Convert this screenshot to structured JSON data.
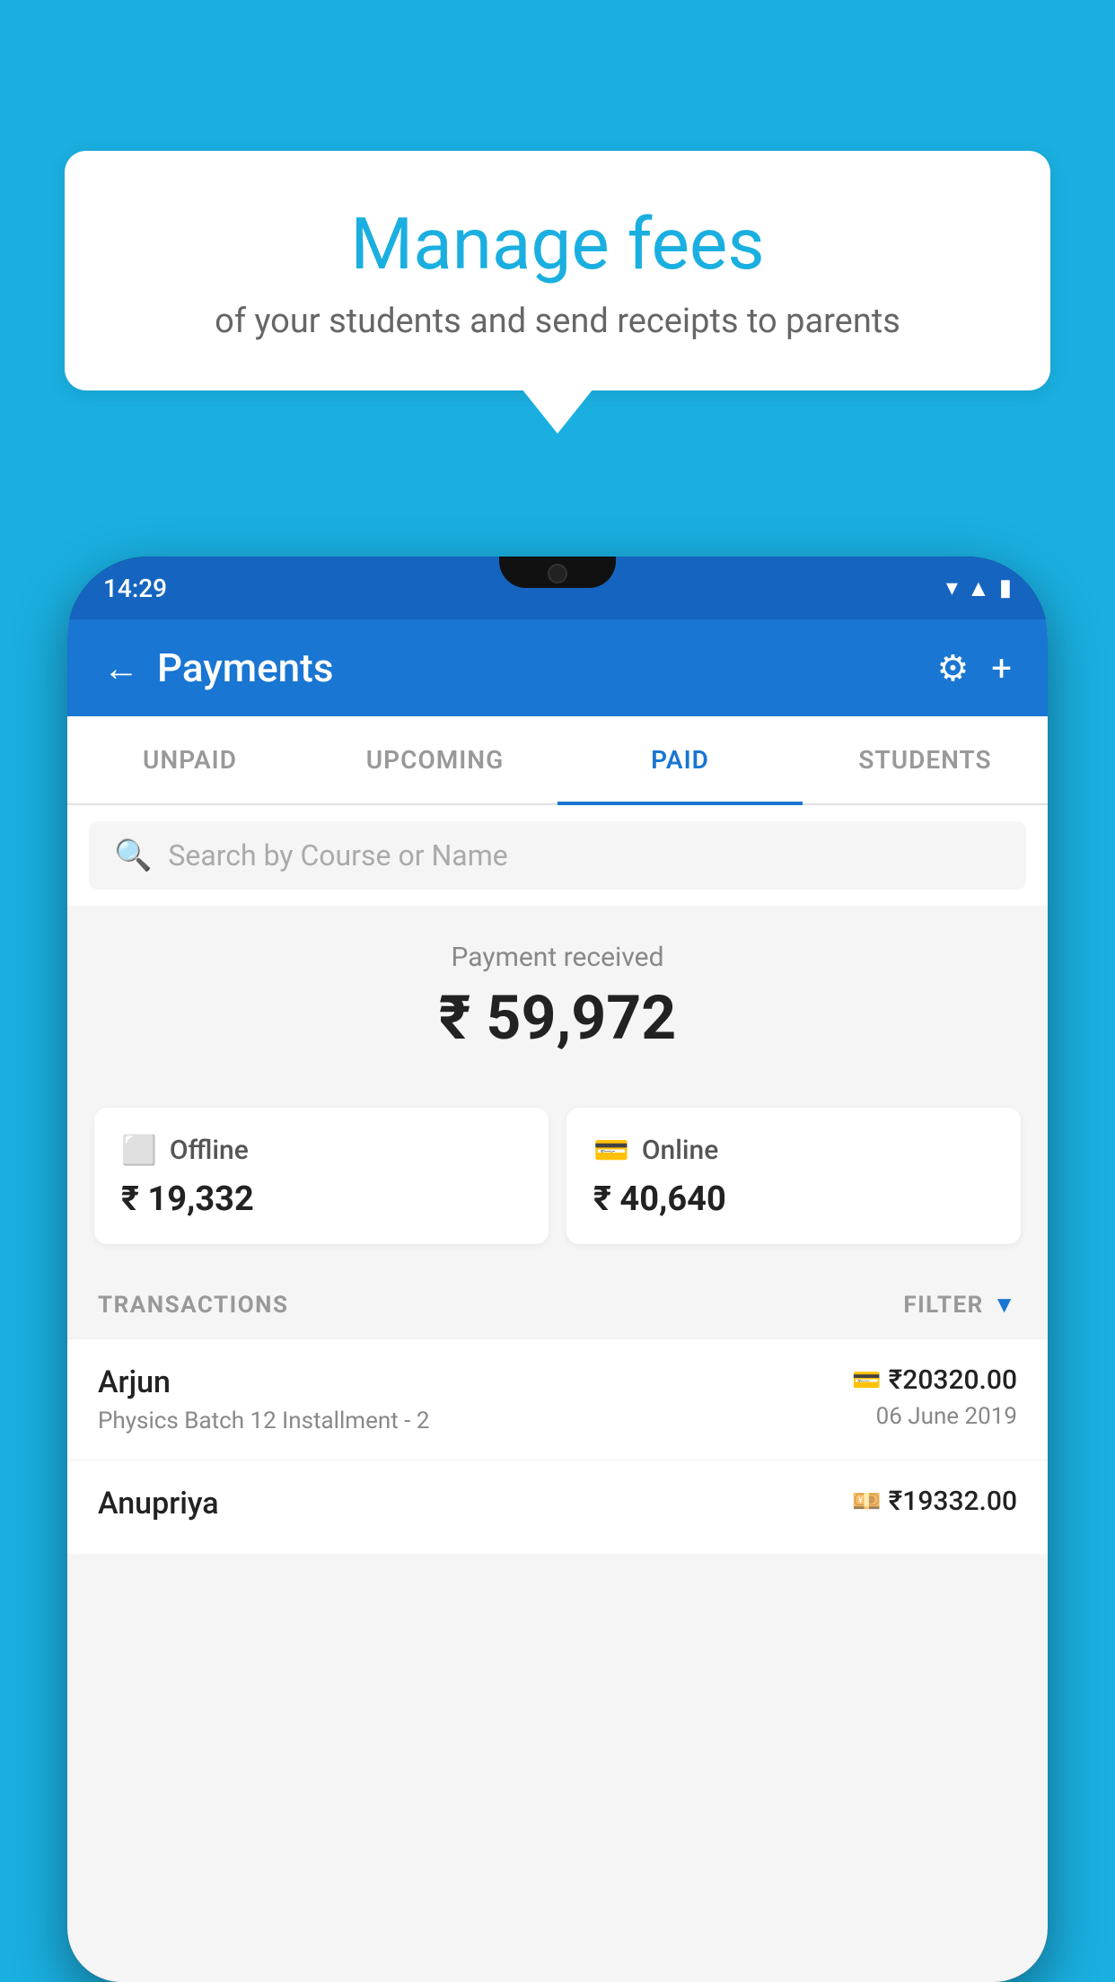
{
  "background_color": "#1AAFE0",
  "speech_bubble": {
    "title": "Manage fees",
    "subtitle": "of your students and send receipts to parents"
  },
  "phone": {
    "status_bar": {
      "time": "14:29",
      "icons": [
        "wifi",
        "signal",
        "battery"
      ]
    },
    "header": {
      "back_label": "←",
      "title": "Payments",
      "gear_icon": "⚙",
      "plus_icon": "+"
    },
    "tabs": [
      {
        "label": "UNPAID",
        "active": false
      },
      {
        "label": "UPCOMING",
        "active": false
      },
      {
        "label": "PAID",
        "active": true
      },
      {
        "label": "STUDENTS",
        "active": false
      }
    ],
    "search": {
      "placeholder": "Search by Course or Name"
    },
    "payment_summary": {
      "label": "Payment received",
      "amount": "₹ 59,972"
    },
    "payment_cards": [
      {
        "icon": "💳",
        "label": "Offline",
        "amount": "₹ 19,332"
      },
      {
        "icon": "💳",
        "label": "Online",
        "amount": "₹ 40,640"
      }
    ],
    "transactions_label": "TRANSACTIONS",
    "filter_label": "FILTER",
    "transactions": [
      {
        "name": "Arjun",
        "detail": "Physics Batch 12 Installment - 2",
        "amount": "₹20320.00",
        "date": "06 June 2019",
        "icon": "💳"
      },
      {
        "name": "Anupriya",
        "detail": "",
        "amount": "₹19332.00",
        "date": "",
        "icon": "💴"
      }
    ]
  }
}
